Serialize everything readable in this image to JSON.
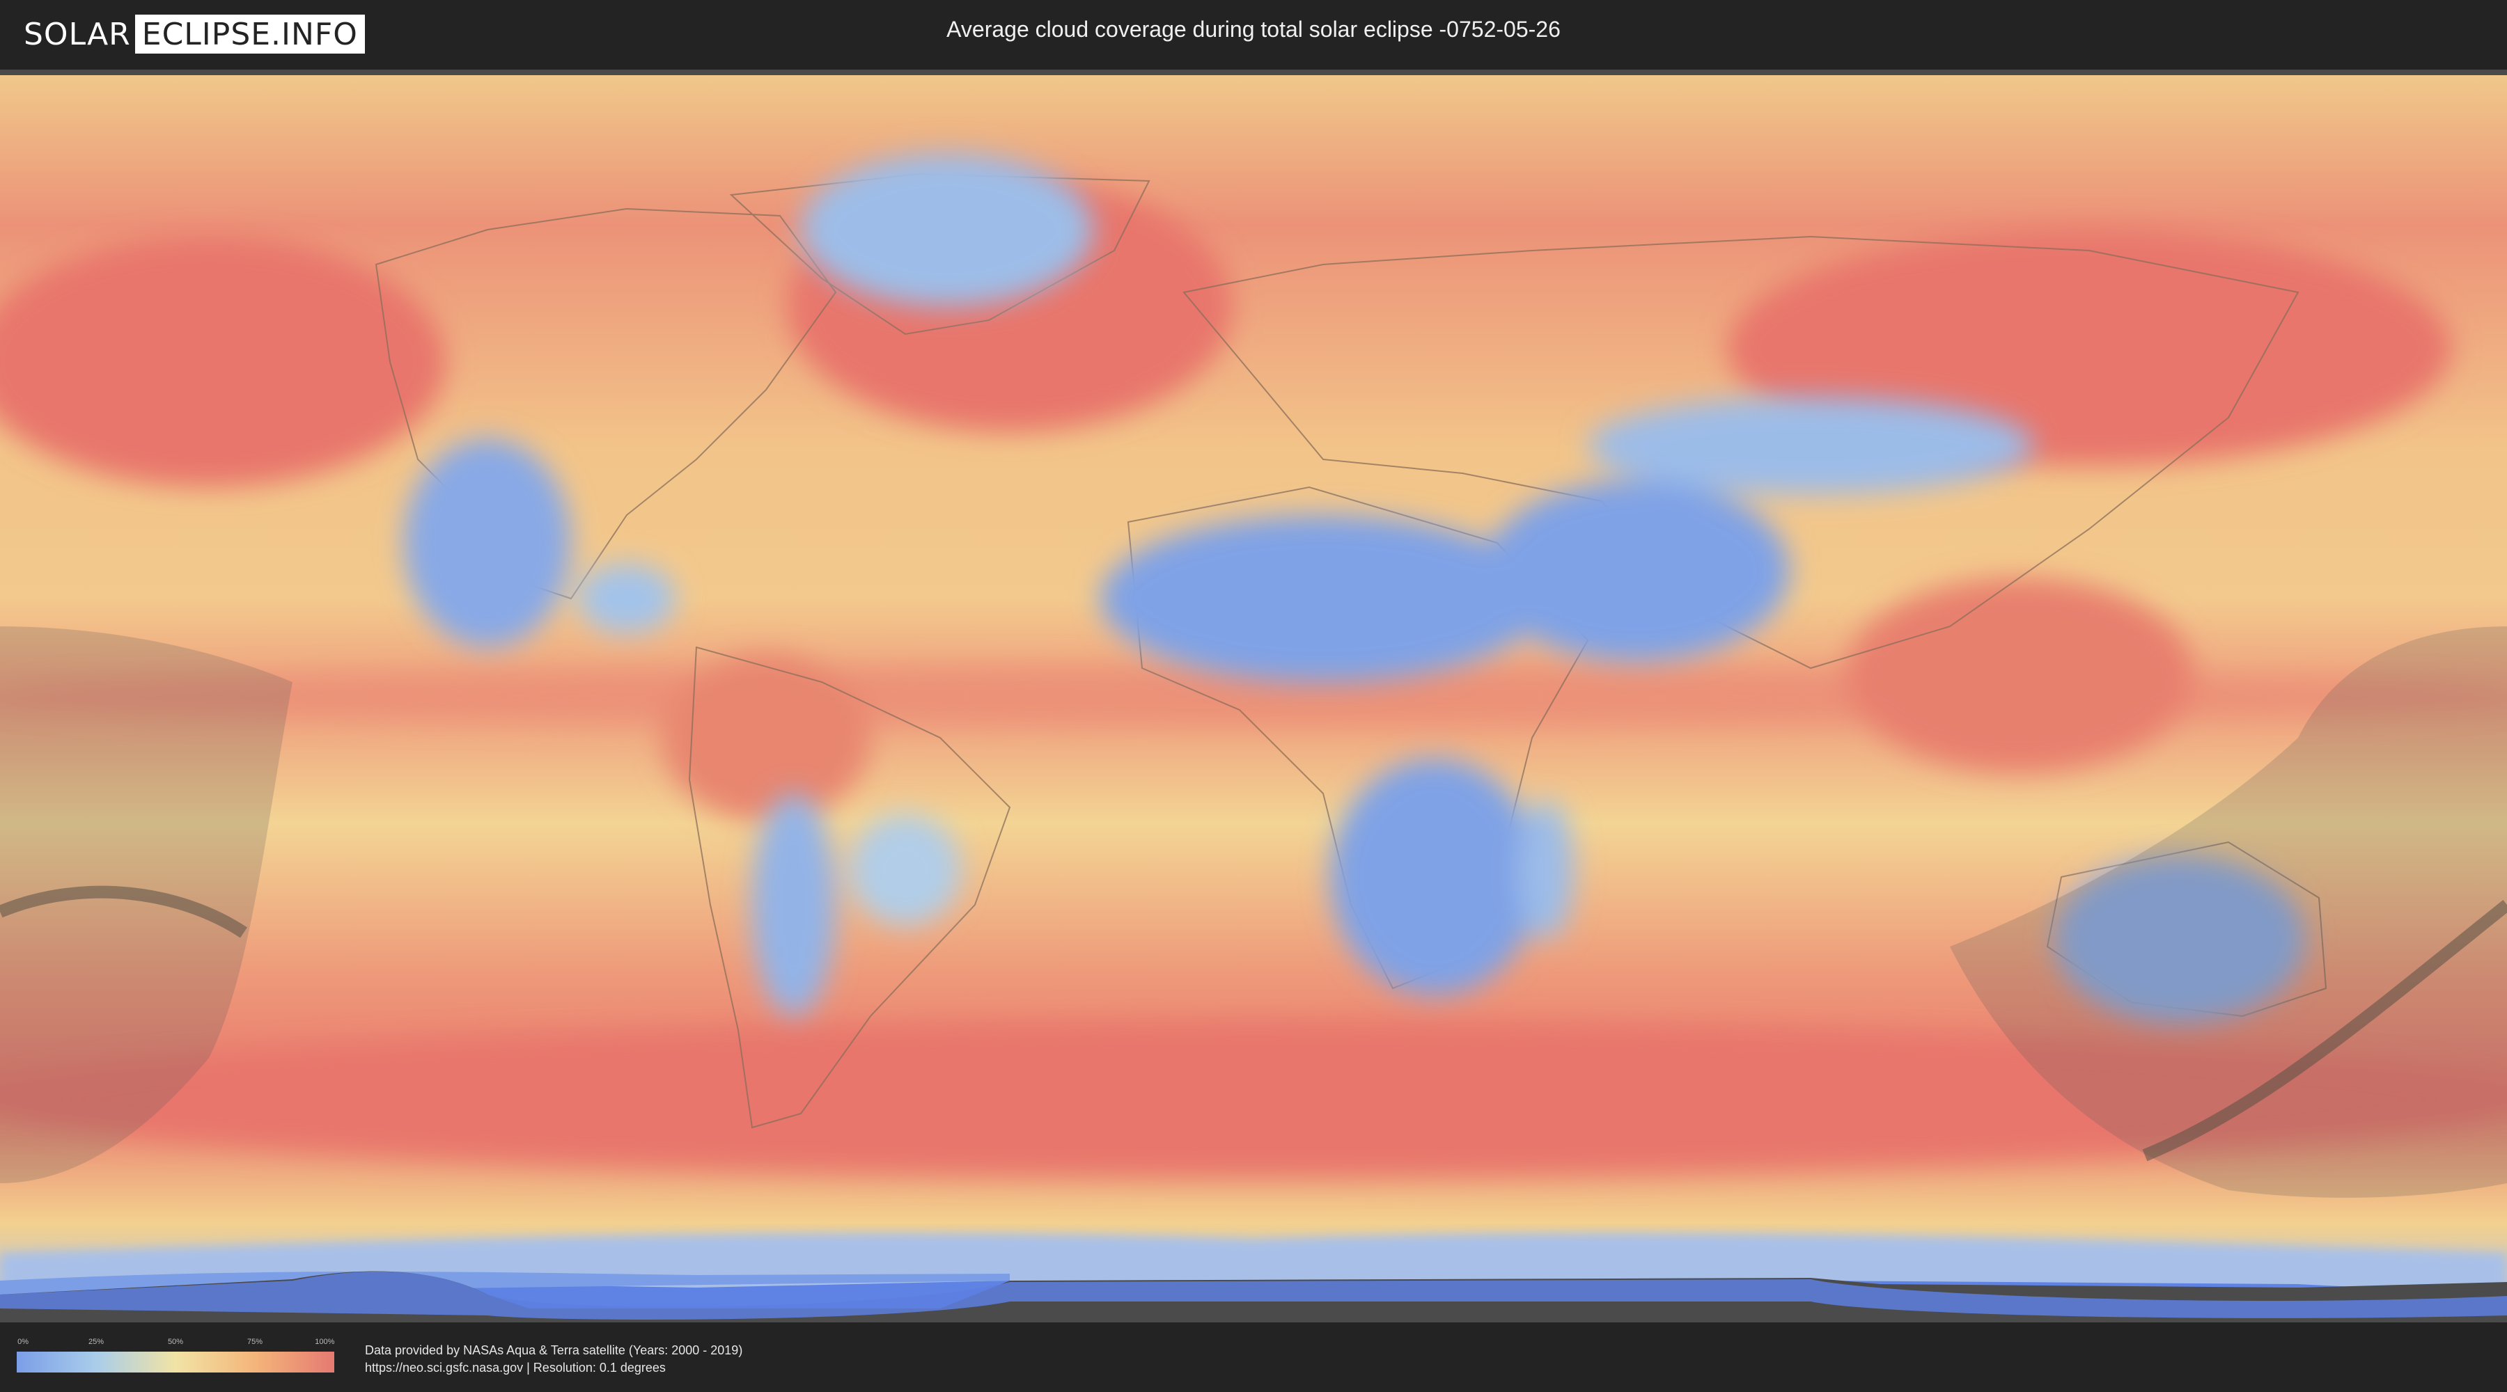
{
  "header": {
    "logo_left": "SOLAR",
    "logo_right": "ECLIPSE.INFO",
    "title": "Average cloud coverage during total solar eclipse -0752-05-26"
  },
  "legend": {
    "ticks": [
      "0%",
      "25%",
      "50%",
      "75%",
      "100%"
    ],
    "colors": [
      "#7b9ee8",
      "#a9cdea",
      "#f1e3a5",
      "#f4b57a",
      "#e57a72"
    ]
  },
  "credits": {
    "line1": "Data provided by NASAs Aqua & Terra satellite (Years: 2000 - 2019)",
    "line2": "https://neo.sci.gsfc.nasa.gov | Resolution: 0.1 degrees"
  },
  "map": {
    "ocean_high_cloud_color": "#e8766c",
    "mid_cloud_color": "#f3d08e",
    "low_cloud_color": "#7fa2e6",
    "antarctica_color": "#5f83e4",
    "shadow_color": "#555555"
  }
}
